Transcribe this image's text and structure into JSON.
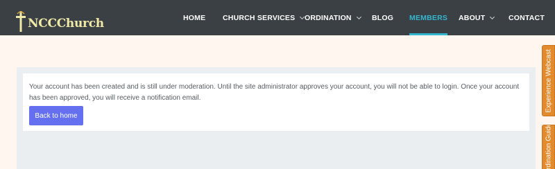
{
  "header": {
    "logo_text": "NCCChurch",
    "logo_icon": "cross-icon",
    "nav": [
      {
        "label": "HOME",
        "dropdown": false,
        "active": false
      },
      {
        "label": "CHURCH SERVICES",
        "dropdown": true,
        "active": false
      },
      {
        "label": "ORDINATION",
        "dropdown": true,
        "active": false
      },
      {
        "label": "BLOG",
        "dropdown": false,
        "active": false
      },
      {
        "label": "MEMBERS",
        "dropdown": false,
        "active": true
      },
      {
        "label": "ABOUT",
        "dropdown": true,
        "active": false
      },
      {
        "label": "CONTACT",
        "dropdown": false,
        "active": false
      }
    ]
  },
  "main": {
    "message": "Your account has been created and is still under moderation. Until the site administrator approves your account, you will not be able to login. Once your account has been approved, you will receive a notification email.",
    "back_button": "Back to home"
  },
  "side_tabs": {
    "webcast": "Experience Webcast",
    "guide": "Ordination Guide"
  },
  "colors": {
    "nav_bg": "#3a4043",
    "active": "#33b6cf",
    "button": "#6470f0",
    "side_tab": "#e38a2d",
    "page_bg": "#fff6ef"
  }
}
